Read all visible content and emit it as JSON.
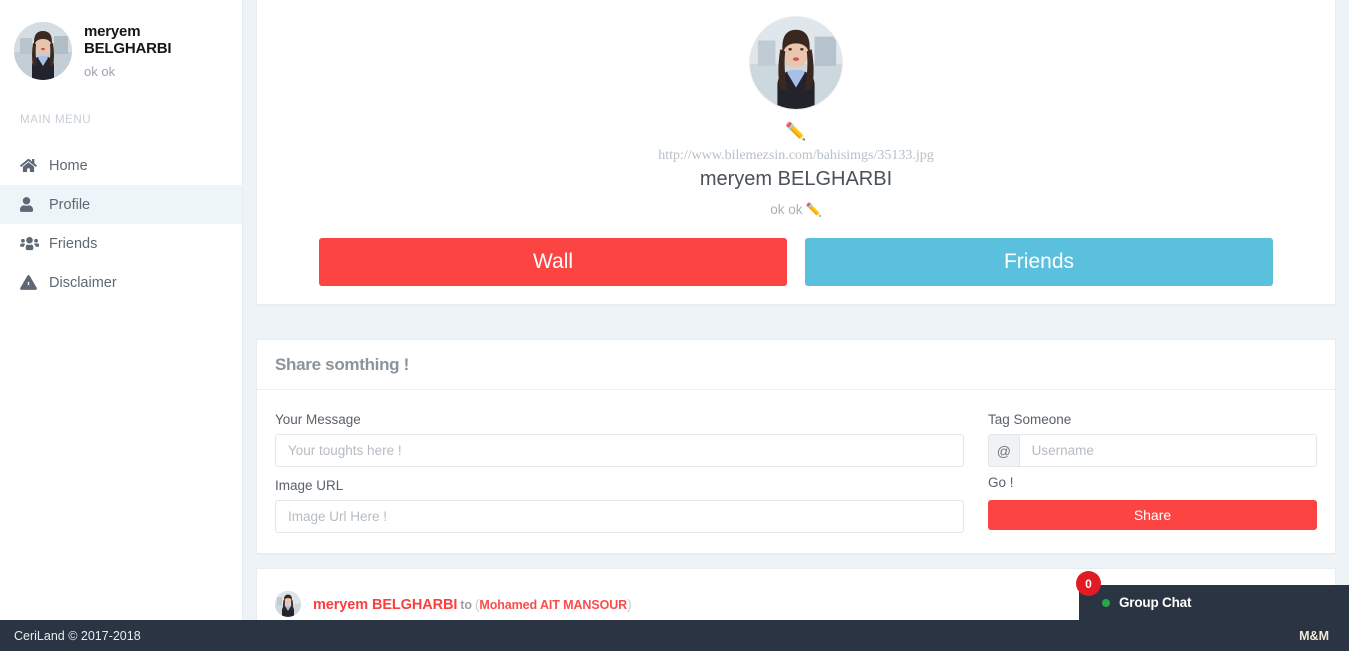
{
  "sidebar": {
    "user": {
      "name": "meryem BELGHARBI",
      "status": "ok ok",
      "avatar_icon": "user-photo"
    },
    "menu_title": "MAIN MENU",
    "items": [
      {
        "label": "Home",
        "icon": "home-icon",
        "active": false
      },
      {
        "label": "Profile",
        "icon": "user-icon",
        "active": true
      },
      {
        "label": "Friends",
        "icon": "users-icon",
        "active": false
      },
      {
        "label": "Disclaimer",
        "icon": "warning-triangle-icon",
        "active": false
      }
    ]
  },
  "profile": {
    "photo_icon": "profile-photo",
    "edit_pencil": "✏️",
    "image_url": "http://www.bilemezsin.com/bahisimgs/35133.jpg",
    "name": "meryem BELGHARBI",
    "bio": "ok ok",
    "bio_pencil": "✏️",
    "tabs": [
      {
        "label": "Wall",
        "color": "#fc4443"
      },
      {
        "label": "Friends",
        "color": "#5bc0de"
      }
    ]
  },
  "share": {
    "title": "Share somthing !",
    "message_label": "Your Message",
    "message_value": "",
    "message_placeholder": "Your toughts here !",
    "image_url_label": "Image URL",
    "image_url_value": "",
    "image_url_placeholder": "Image Url Here !",
    "tag_label": "Tag Someone",
    "tag_addon": "@",
    "tag_value": "",
    "tag_placeholder": "Username",
    "go_label": "Go !",
    "share_button": "Share"
  },
  "feed": {
    "posts": [
      {
        "author": "meryem BELGHARBI",
        "connector": "to",
        "open_paren": "(",
        "target": "Mohamed AIT MANSOUR",
        "close_paren": ")",
        "avatar_icon": "post-avatar"
      }
    ]
  },
  "chat": {
    "badge_count": "0",
    "label": "Group Chat",
    "status_color": "#28a745"
  },
  "footer": {
    "left": "CeriLand © 2017-2018",
    "right": "M&M"
  }
}
